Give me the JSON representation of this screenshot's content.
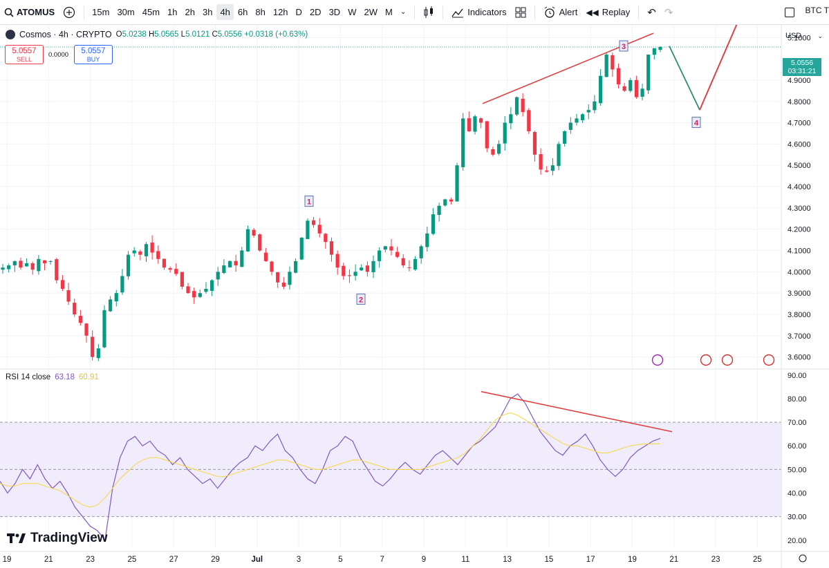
{
  "toolbar": {
    "symbol": "ATOMUS",
    "intervals": [
      "15m",
      "30m",
      "45m",
      "1h",
      "2h",
      "3h",
      "4h",
      "6h",
      "8h",
      "12h",
      "D",
      "2D",
      "3D",
      "W",
      "2W",
      "M"
    ],
    "active_interval": "4h",
    "indicators_label": "Indicators",
    "alert_label": "Alert",
    "replay_label": "Replay",
    "right_label": "BTC T"
  },
  "legend": {
    "name": "Cosmos · 4h · CRYPTO",
    "o_label": "O",
    "o": "5.0238",
    "h_label": "H",
    "h": "5.0565",
    "l_label": "L",
    "l": "5.0121",
    "c_label": "C",
    "c": "5.0556",
    "change": "+0.0318 (+0.63%)"
  },
  "trade": {
    "sell_price": "5.0557",
    "sell_label": "SELL",
    "spread": "0.0000",
    "buy_price": "5.0557",
    "buy_label": "BUY"
  },
  "currency": "USD",
  "last_price_tag": {
    "price": "5.0556",
    "countdown": "03:31:21"
  },
  "rsi": {
    "label": "RSI 14 close",
    "rsi_value": "63.18",
    "ma_value": "60.91"
  },
  "brand": "TradingView",
  "colors": {
    "up": "#089981",
    "down": "#f23645",
    "rsi": "#7e57c2",
    "rsi_ma": "#f5d742",
    "annot_red": "#e04040",
    "annot_green": "#2e8b74",
    "rsi_band": "#f1ecfb"
  },
  "chart_data": [
    {
      "type": "candlestick",
      "title": "Cosmos · 4h · CRYPTO",
      "x_ticks": [
        "19",
        "21",
        "23",
        "25",
        "27",
        "29",
        "Jul",
        "3",
        "5",
        "7",
        "9",
        "11",
        "13",
        "15",
        "17",
        "19",
        "21",
        "23",
        "25"
      ],
      "y_ticks": [
        "3.6000",
        "3.7000",
        "3.8000",
        "3.9000",
        "4.0000",
        "4.1000",
        "4.2000",
        "4.3000",
        "4.4000",
        "4.5000",
        "4.6000",
        "4.7000",
        "4.8000",
        "4.9000",
        "5.1000"
      ],
      "ylim": [
        3.55,
        5.14
      ],
      "path_closes": [
        4.02,
        4.03,
        4.05,
        4.02,
        4.04,
        4.01,
        4.06,
        4.04,
        4.05,
        3.96,
        3.92,
        3.86,
        3.8,
        3.76,
        3.7,
        3.6,
        3.64,
        3.82,
        3.87,
        3.9,
        3.98,
        4.08,
        4.1,
        4.08,
        4.13,
        4.09,
        4.06,
        4.02,
        4.01,
        3.99,
        3.93,
        3.9,
        3.88,
        3.9,
        3.92,
        3.96,
        4.0,
        4.03,
        4.05,
        4.03,
        4.1,
        4.2,
        4.17,
        4.1,
        4.05,
        4.0,
        3.95,
        3.93,
        4.0,
        4.05,
        4.16,
        4.24,
        4.22,
        4.18,
        4.14,
        4.08,
        4.02,
        3.98,
        3.98,
        4.0,
        4.02,
        4.0,
        4.05,
        4.1,
        4.12,
        4.1,
        4.07,
        4.03,
        4.02,
        4.06,
        4.12,
        4.18,
        4.27,
        4.31,
        4.34,
        4.33,
        4.5,
        4.72,
        4.66,
        4.73,
        4.7,
        4.58,
        4.55,
        4.6,
        4.7,
        4.74,
        4.82,
        4.75,
        4.66,
        4.55,
        4.48,
        4.47,
        4.5,
        4.6,
        4.66,
        4.7,
        4.72,
        4.74,
        4.76,
        4.8,
        4.92,
        5.02,
        4.95,
        4.88,
        4.85,
        4.9,
        4.82,
        4.86,
        5.02,
        5.05,
        5.056
      ],
      "annotations": [
        {
          "text": "1",
          "price": 4.33
        },
        {
          "text": "2",
          "price": 3.89
        },
        {
          "text": "3",
          "price": 5.1
        },
        {
          "text": "4",
          "price": 4.7
        }
      ]
    },
    {
      "type": "line",
      "title": "RSI 14 close",
      "ylim": [
        17,
        92
      ],
      "y_ticks": [
        "20.00",
        "30.00",
        "40.00",
        "50.00",
        "60.00",
        "70.00",
        "80.00",
        "90.00"
      ],
      "bands": [
        30,
        50,
        70
      ],
      "series": [
        {
          "name": "RSI",
          "values": [
            45,
            40,
            44,
            50,
            46,
            52,
            46,
            42,
            45,
            40,
            34,
            30,
            26,
            24,
            20,
            42,
            55,
            62,
            64,
            60,
            62,
            58,
            56,
            52,
            55,
            50,
            47,
            44,
            46,
            42,
            46,
            50,
            53,
            55,
            60,
            58,
            62,
            65,
            58,
            55,
            50,
            46,
            44,
            50,
            58,
            60,
            64,
            62,
            55,
            50,
            45,
            43,
            46,
            50,
            53,
            50,
            48,
            52,
            56,
            58,
            55,
            52,
            56,
            60,
            62,
            65,
            68,
            74,
            80,
            82,
            78,
            72,
            66,
            62,
            58,
            56,
            60,
            62,
            65,
            60,
            54,
            50,
            47,
            50,
            55,
            58,
            60,
            62,
            63.18
          ]
        },
        {
          "name": "RSI MA",
          "values": [
            44,
            43,
            43,
            44,
            44,
            44,
            43,
            42,
            41,
            39,
            37,
            35,
            34,
            35,
            38,
            42,
            46,
            49,
            52,
            54,
            55,
            55,
            54,
            53,
            52,
            51,
            50,
            49,
            48,
            47,
            47,
            48,
            49,
            50,
            51,
            52,
            53,
            54,
            54,
            53,
            52,
            51,
            50,
            50,
            51,
            52,
            53,
            54,
            54,
            53,
            52,
            51,
            50,
            50,
            50,
            50,
            50,
            51,
            52,
            53,
            54,
            55,
            57,
            60,
            63,
            67,
            71,
            73,
            74,
            73,
            71,
            69,
            67,
            65,
            63,
            61,
            60,
            60,
            59,
            58,
            57,
            57,
            58,
            59,
            60,
            60.5,
            60.8,
            60.9,
            60.91
          ]
        }
      ]
    }
  ]
}
